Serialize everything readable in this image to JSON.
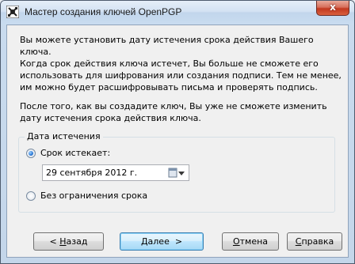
{
  "window": {
    "title": "Мастер создания ключей OpenPGP",
    "close_glyph": "x",
    "icon": "gpg-app-icon"
  },
  "content": {
    "intro": "Вы можете установить дату истечения срока действия Вашего ключа.",
    "expiry_note": "Когда срок действия ключа истечет, Вы больше не сможете его использовать для шифрования или создания подписи. Тем не менее, им можно будет расшифровывать письма и проверять подпись.",
    "change_note": "После того, как вы создадите ключ, Вы уже не сможете изменить дату истечения срока действия ключа."
  },
  "expiry_group": {
    "legend": "Дата истечения",
    "option_expires_label": "Срок истекает:",
    "option_expires_selected": true,
    "date_value": "29 сентября 2012 г.",
    "option_unlimited_label": "Без ограничения срока",
    "option_unlimited_selected": false
  },
  "buttons": {
    "back": {
      "prefix": "< ",
      "accel": "Н",
      "rest": "азад"
    },
    "next": {
      "accel": "Д",
      "rest": "алее  >"
    },
    "cancel": {
      "accel": "О",
      "rest": "тмена"
    },
    "help": {
      "accel": "С",
      "rest": "правка"
    }
  },
  "colors": {
    "accent": "#3c7fb1",
    "close": "#c2381f"
  }
}
